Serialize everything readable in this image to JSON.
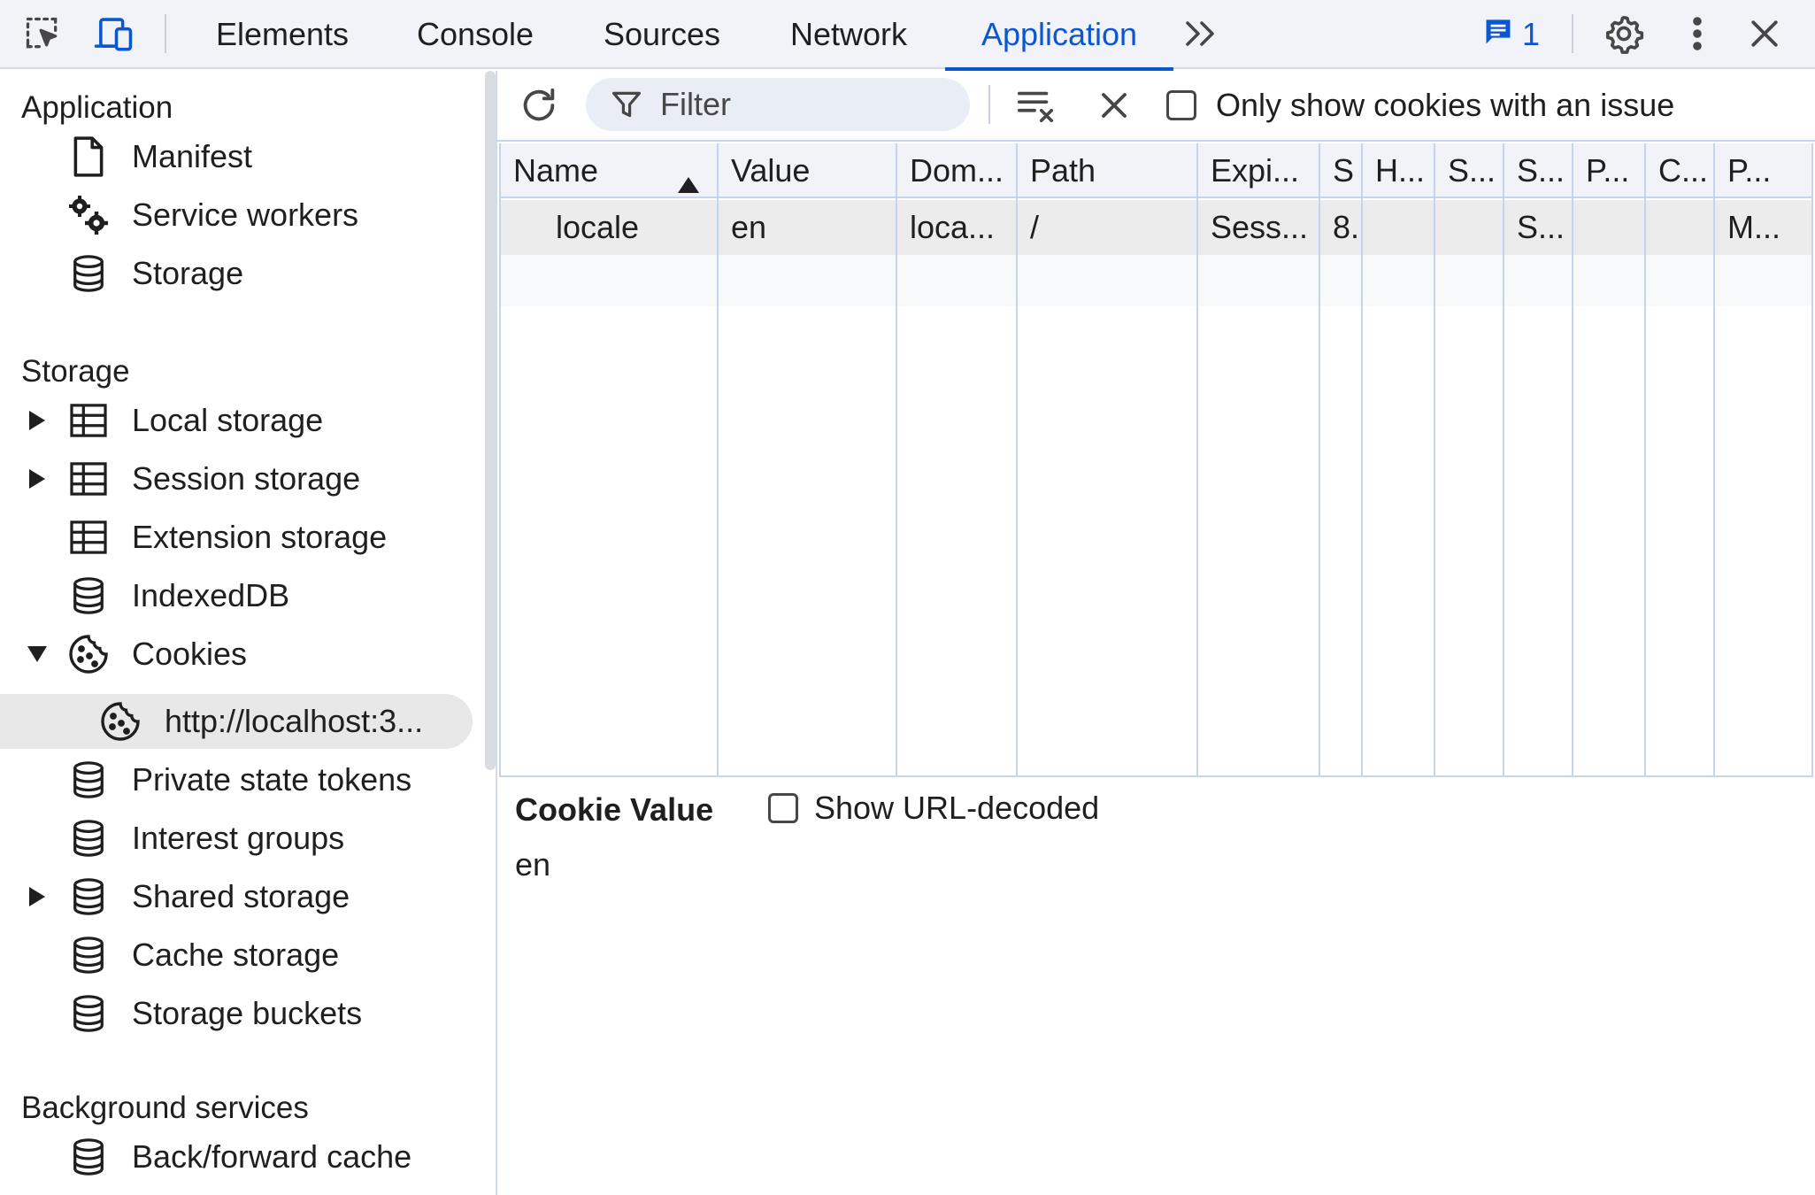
{
  "tabs": {
    "items": [
      {
        "label": "Elements"
      },
      {
        "label": "Console"
      },
      {
        "label": "Sources"
      },
      {
        "label": "Network"
      },
      {
        "label": "Application"
      }
    ],
    "active": "Application",
    "more_icon": "chevron-double-right-icon",
    "issues_count": "1"
  },
  "sidebar": {
    "sections": [
      {
        "title": "Application",
        "items": [
          {
            "label": "Manifest",
            "icon": "document-icon"
          },
          {
            "label": "Service workers",
            "icon": "gears-icon"
          },
          {
            "label": "Storage",
            "icon": "database-icon"
          }
        ]
      },
      {
        "title": "Storage",
        "items": [
          {
            "label": "Local storage",
            "icon": "table-icon",
            "expandable": true,
            "expanded": false
          },
          {
            "label": "Session storage",
            "icon": "table-icon",
            "expandable": true,
            "expanded": false
          },
          {
            "label": "Extension storage",
            "icon": "table-icon"
          },
          {
            "label": "IndexedDB",
            "icon": "database-icon"
          },
          {
            "label": "Cookies",
            "icon": "cookie-icon",
            "expandable": true,
            "expanded": true
          },
          {
            "label": "http://localhost:3...",
            "icon": "cookie-icon",
            "selected": true
          },
          {
            "label": "Private state tokens",
            "icon": "database-icon"
          },
          {
            "label": "Interest groups",
            "icon": "database-icon"
          },
          {
            "label": "Shared storage",
            "icon": "database-icon",
            "expandable": true,
            "expanded": false
          },
          {
            "label": "Cache storage",
            "icon": "database-icon"
          },
          {
            "label": "Storage buckets",
            "icon": "database-icon"
          }
        ]
      },
      {
        "title": "Background services",
        "items": [
          {
            "label": "Back/forward cache",
            "icon": "database-icon"
          }
        ]
      }
    ]
  },
  "toolbar": {
    "filter_placeholder": "Filter",
    "only_issues_label": "Only show cookies with an issue",
    "only_issues_checked": false
  },
  "cookies_table": {
    "columns": [
      "Name",
      "Value",
      "Dom...",
      "Path",
      "Expi...",
      "S",
      "H...",
      "S...",
      "S...",
      "P...",
      "C...",
      "P..."
    ],
    "sort_column": "Name",
    "sort_direction": "ascending",
    "rows": [
      [
        "locale",
        "en",
        "loca...",
        "/",
        "Sess...",
        "8.",
        "",
        "",
        "S...",
        "",
        "",
        "M..."
      ]
    ]
  },
  "value_pane": {
    "title": "Cookie Value",
    "decode_label": "Show URL-decoded",
    "decode_checked": false,
    "value": "en"
  },
  "colors": {
    "accent": "#0b57d0",
    "bar_bg": "#f1f3f9",
    "grid_line": "#c6d4ee",
    "selected_row": "#ececec"
  }
}
